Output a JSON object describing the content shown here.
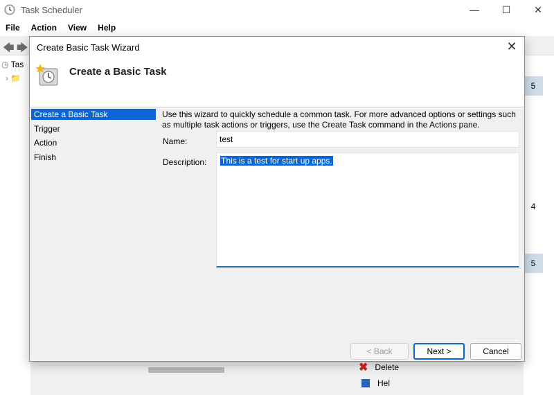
{
  "main_window": {
    "title": "Task Scheduler",
    "menu": [
      "File",
      "Action",
      "View",
      "Help"
    ],
    "tree_root_label": "Tas",
    "counts": [
      "5",
      "4",
      "5"
    ],
    "delete_label": "Delete",
    "help_label": "Hel"
  },
  "wizard": {
    "title": "Create Basic Task Wizard",
    "header_title": "Create a Basic Task",
    "steps": [
      "Create a Basic Task",
      "Trigger",
      "Action",
      "Finish"
    ],
    "intro": "Use this wizard to quickly schedule a common task.  For more advanced options or settings such as multiple task actions or triggers, use the Create Task command in the Actions pane.",
    "name_label": "Name:",
    "name_value": "test",
    "description_label": "Description:",
    "description_value": "This is a test for start up apps.",
    "back_label": "< Back",
    "next_label": "Next >",
    "cancel_label": "Cancel"
  }
}
